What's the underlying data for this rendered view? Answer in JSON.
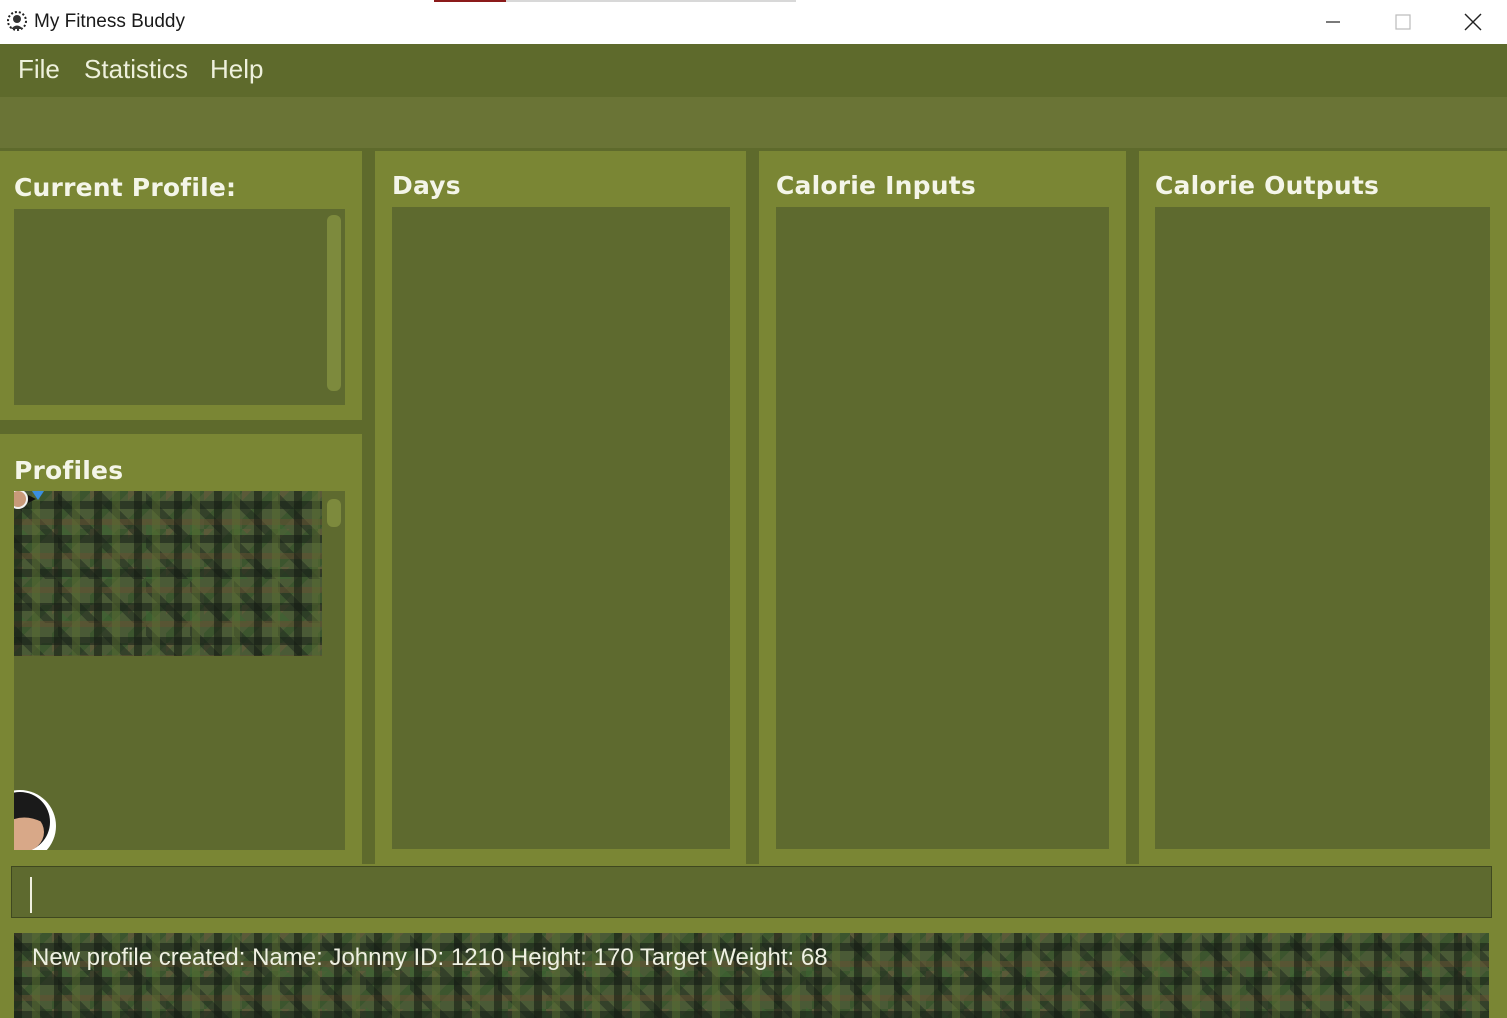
{
  "window": {
    "title": "My Fitness Buddy",
    "icon": "fitness-buddy-logo-icon"
  },
  "menu": {
    "items": [
      "File",
      "Statistics",
      "Help"
    ]
  },
  "panels": {
    "current_profile": {
      "title": "Current Profile:"
    },
    "profiles": {
      "title": "Profiles"
    },
    "days": {
      "title": "Days"
    },
    "calorie_inputs": {
      "title": "Calorie Inputs"
    },
    "calorie_outputs": {
      "title": "Calorie Outputs"
    }
  },
  "command": {
    "value": ""
  },
  "result": {
    "message": "New profile created:  Name: Johnny ID: 1210 Height: 170 Target Weight: 68"
  },
  "colors": {
    "menu_bg": "#5e6a2c",
    "panel_bg": "#7a8634",
    "list_bg": "#5e6a2f",
    "text": "#f4f5e8"
  }
}
